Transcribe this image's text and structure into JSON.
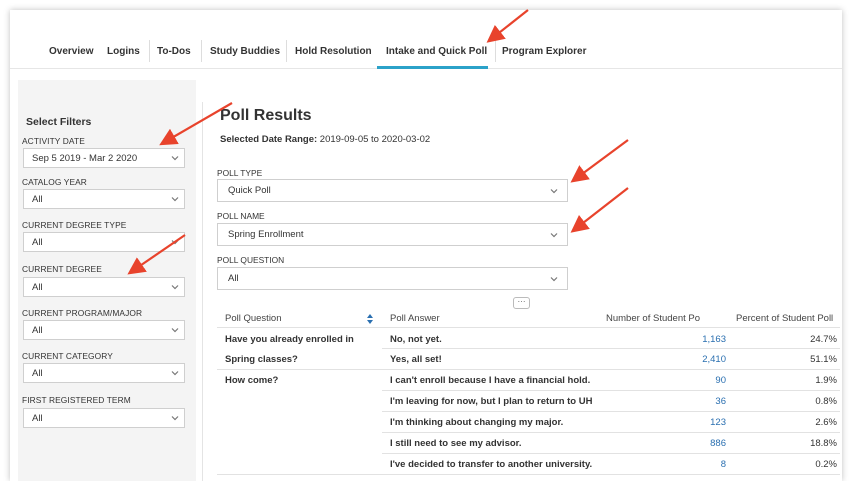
{
  "tabs": [
    {
      "label": "Overview"
    },
    {
      "label": "Logins"
    },
    {
      "label": "To-Dos"
    },
    {
      "label": "Study Buddies"
    },
    {
      "label": "Hold Resolution"
    },
    {
      "label": "Intake and Quick Poll",
      "active": true
    },
    {
      "label": "Program Explorer"
    }
  ],
  "sidebar": {
    "title": "Select Filters",
    "filters": [
      {
        "label": "ACTIVITY DATE",
        "value": "Sep 5 2019 - Mar 2 2020"
      },
      {
        "label": "CATALOG YEAR",
        "value": "All"
      },
      {
        "label": "CURRENT DEGREE TYPE",
        "value": "All"
      },
      {
        "label": "CURRENT DEGREE",
        "value": "All"
      },
      {
        "label": "CURRENT PROGRAM/MAJOR",
        "value": "All"
      },
      {
        "label": "CURRENT CATEGORY",
        "value": "All"
      },
      {
        "label": "FIRST REGISTERED TERM",
        "value": "All"
      }
    ]
  },
  "main": {
    "title": "Poll Results",
    "date_range_label": "Selected Date Range:",
    "date_range_value": "2019-09-05 to 2020-03-02",
    "poll_type": {
      "label": "POLL TYPE",
      "value": "Quick Poll"
    },
    "poll_name": {
      "label": "POLL NAME",
      "value": "Spring Enrollment"
    },
    "poll_question": {
      "label": "POLL QUESTION",
      "value": "All"
    },
    "more_label": "···"
  },
  "table": {
    "headers": [
      "Poll Question",
      "Poll Answer",
      "Number of Student Po",
      "Percent of Student Poll"
    ],
    "questions": [
      {
        "line1": "Have you already enrolled in",
        "line2": "Spring classes?"
      },
      {
        "line1": "How come?"
      }
    ],
    "rows": [
      {
        "answer": "No, not yet.",
        "count": "1,163",
        "pct": "24.7%"
      },
      {
        "answer": "Yes, all set!",
        "count": "2,410",
        "pct": "51.1%"
      },
      {
        "answer": "I can't enroll because I have a financial hold.",
        "count": "90",
        "pct": "1.9%"
      },
      {
        "answer": "I'm leaving for now, but I plan to return to UH",
        "count": "36",
        "pct": "0.8%"
      },
      {
        "answer": "I'm thinking about changing my major.",
        "count": "123",
        "pct": "2.6%"
      },
      {
        "answer": "I still need to see my advisor.",
        "count": "886",
        "pct": "18.8%"
      },
      {
        "answer": "I've decided to transfer to another university.",
        "count": "8",
        "pct": "0.2%"
      }
    ]
  },
  "colors": {
    "accent": "#2ba2c9",
    "annotation": "#e8432c",
    "link": "#2a6fb0"
  }
}
